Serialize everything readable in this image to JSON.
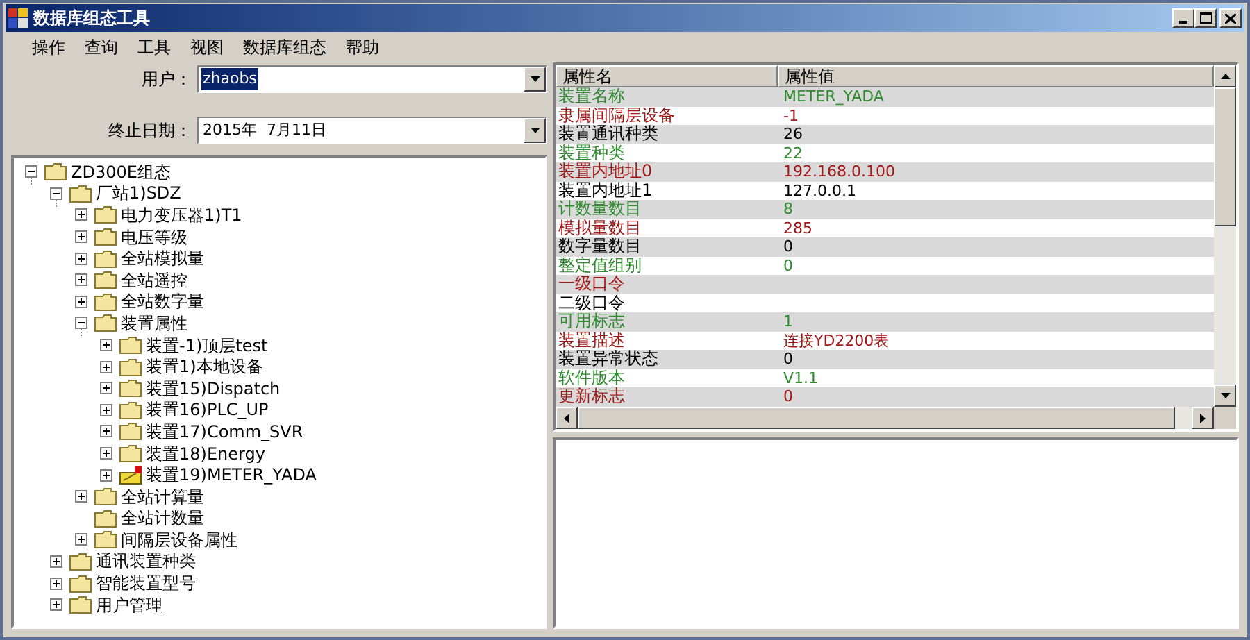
{
  "window": {
    "title": "数据库组态工具"
  },
  "menu": [
    "操作",
    "查询",
    "工具",
    "视图",
    "数据库组态",
    "帮助"
  ],
  "user_field": {
    "label": "用户：",
    "value": "zhaobs"
  },
  "date_field": {
    "label": "终止日期：",
    "value": "2015年  7月11日"
  },
  "tree": [
    {
      "label": "ZD300E组态",
      "kind": "folder",
      "expandable": true,
      "expanded": true,
      "children": [
        {
          "label": "厂站1)SDZ",
          "kind": "folder",
          "expandable": true,
          "expanded": true,
          "children": [
            {
              "label": "电力变压器1)T1",
              "kind": "folder",
              "expandable": true,
              "expanded": false
            },
            {
              "label": "电压等级",
              "kind": "folder",
              "expandable": true,
              "expanded": false
            },
            {
              "label": "全站模拟量",
              "kind": "folder",
              "expandable": true,
              "expanded": false
            },
            {
              "label": "全站遥控",
              "kind": "folder",
              "expandable": true,
              "expanded": false
            },
            {
              "label": "全站数字量",
              "kind": "folder",
              "expandable": true,
              "expanded": false
            },
            {
              "label": "装置属性",
              "kind": "folder",
              "expandable": true,
              "expanded": true,
              "children": [
                {
                  "label": "装置-1)顶层test",
                  "kind": "folder",
                  "expandable": true,
                  "expanded": false
                },
                {
                  "label": "装置1)本地设备",
                  "kind": "folder",
                  "expandable": true,
                  "expanded": false
                },
                {
                  "label": "装置15)Dispatch",
                  "kind": "folder",
                  "expandable": true,
                  "expanded": false
                },
                {
                  "label": "装置16)PLC_UP",
                  "kind": "folder",
                  "expandable": true,
                  "expanded": false
                },
                {
                  "label": "装置17)Comm_SVR",
                  "kind": "folder",
                  "expandable": true,
                  "expanded": false
                },
                {
                  "label": "装置18)Energy",
                  "kind": "folder",
                  "expandable": true,
                  "expanded": false
                },
                {
                  "label": "装置19)METER_YADA",
                  "kind": "flagged",
                  "expandable": true,
                  "expanded": false
                }
              ]
            },
            {
              "label": "全站计算量",
              "kind": "folder",
              "expandable": true,
              "expanded": false
            },
            {
              "label": "全站计数量",
              "kind": "folder",
              "expandable": false,
              "expanded": false
            },
            {
              "label": "间隔层设备属性",
              "kind": "folder",
              "expandable": true,
              "expanded": false
            }
          ]
        },
        {
          "label": "通讯装置种类",
          "kind": "folder",
          "expandable": true,
          "expanded": false
        },
        {
          "label": "智能装置型号",
          "kind": "folder",
          "expandable": true,
          "expanded": false
        },
        {
          "label": "用户管理",
          "kind": "folder",
          "expandable": true,
          "expanded": false
        }
      ]
    }
  ],
  "properties": {
    "columns": [
      "属性名",
      "属性值"
    ],
    "rows": [
      {
        "name": "装置名称",
        "value": "METER_YADA",
        "color": "#2e8b2e"
      },
      {
        "name": "隶属间隔层设备",
        "value": "-1",
        "color": "#a01818"
      },
      {
        "name": "装置通讯种类",
        "value": "26",
        "color": "#000000"
      },
      {
        "name": "装置种类",
        "value": "22",
        "color": "#2e8b2e"
      },
      {
        "name": "装置内地址0",
        "value": "192.168.0.100",
        "color": "#a01818"
      },
      {
        "name": "装置内地址1",
        "value": "127.0.0.1",
        "color": "#000000"
      },
      {
        "name": "计数量数目",
        "value": "8",
        "color": "#2e8b2e"
      },
      {
        "name": "模拟量数目",
        "value": "285",
        "color": "#a01818"
      },
      {
        "name": "数字量数目",
        "value": "0",
        "color": "#000000"
      },
      {
        "name": "整定值组别",
        "value": "0",
        "color": "#2e8b2e"
      },
      {
        "name": "一级口令",
        "value": "",
        "color": "#a01818"
      },
      {
        "name": "二级口令",
        "value": "",
        "color": "#000000"
      },
      {
        "name": "可用标志",
        "value": "1",
        "color": "#2e8b2e"
      },
      {
        "name": "装置描述",
        "value": "连接YD2200表",
        "color": "#a01818"
      },
      {
        "name": "装置异常状态",
        "value": "0",
        "color": "#000000"
      },
      {
        "name": "软件版本",
        "value": "V1.1",
        "color": "#2e8b2e"
      },
      {
        "name": "更新标志",
        "value": "0",
        "color": "#a01818"
      }
    ]
  }
}
